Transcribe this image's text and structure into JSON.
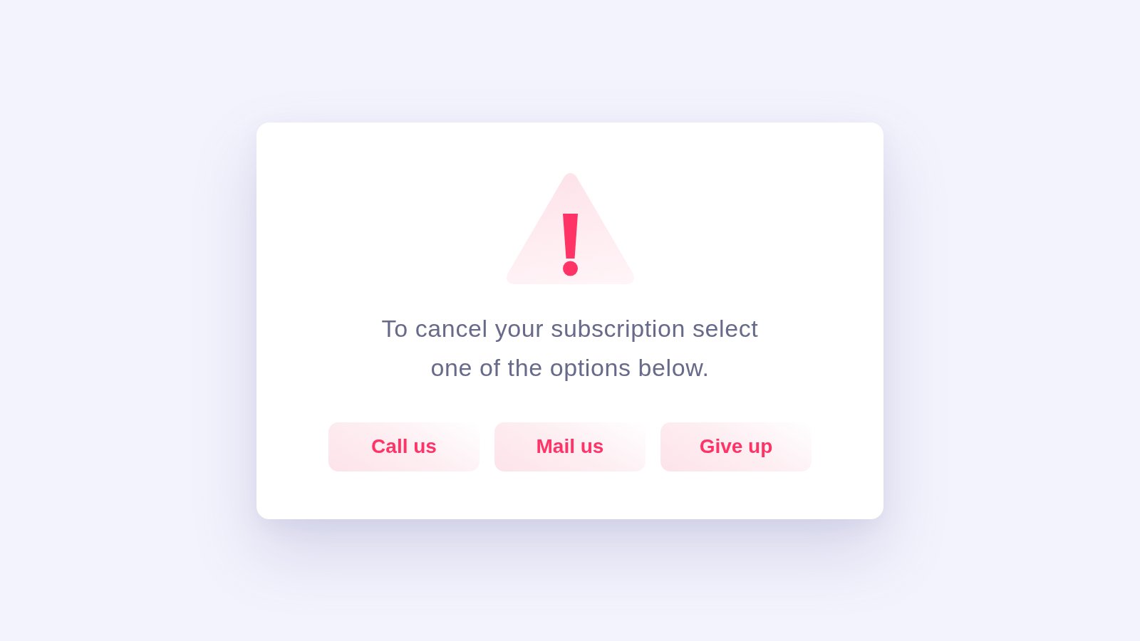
{
  "dialog": {
    "message": "To cancel your subscription select one of the options below.",
    "buttons": [
      {
        "label": "Call us"
      },
      {
        "label": "Mail us"
      },
      {
        "label": "Give up"
      }
    ]
  }
}
